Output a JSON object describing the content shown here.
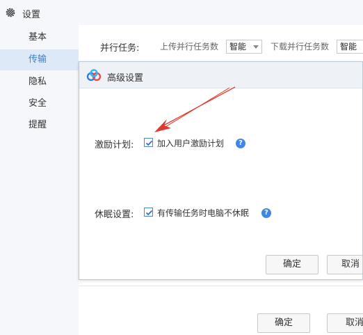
{
  "window": {
    "title": "设置"
  },
  "sidebar": {
    "items": [
      {
        "label": "基本",
        "active": false
      },
      {
        "label": "传输",
        "active": true
      },
      {
        "label": "隐私",
        "active": false
      },
      {
        "label": "安全",
        "active": false
      },
      {
        "label": "提醒",
        "active": false
      }
    ]
  },
  "transfer": {
    "parallel_label": "并行任务:",
    "upload_label": "上传并行任务数",
    "upload_value": "智能",
    "download_label": "下载并行任务数",
    "download_value": "智能"
  },
  "dialog": {
    "title": "高级设置",
    "incentive_label": "激励计划:",
    "incentive_option": "加入用户激励计划",
    "incentive_checked": true,
    "sleep_label": "休眠设置:",
    "sleep_option": "有传输任务时电脑不休眠",
    "sleep_checked": true,
    "help_glyph": "?",
    "ok_label": "确定",
    "cancel_label": "取消"
  },
  "footer": {
    "ok_label": "确定",
    "cancel_label": "取消"
  },
  "colors": {
    "accent": "#3b7fd0",
    "checkbox": "#4a86d9",
    "help": "#3f86e6",
    "annotation_arrow": "#e0392f"
  }
}
